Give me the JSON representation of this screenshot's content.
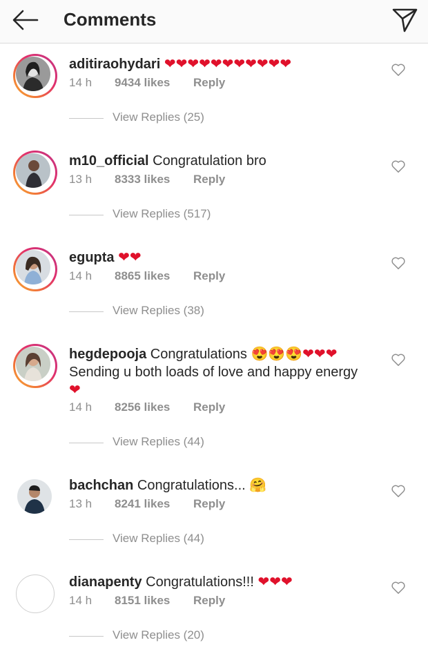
{
  "header": {
    "title": "Comments",
    "back_icon": "arrow-left-icon",
    "direct_icon": "paper-plane-icon"
  },
  "colors": {
    "heart": "#e0112b",
    "muted": "#8e8e8e",
    "story_ring": [
      "#f9b234",
      "#e1306c",
      "#c13584"
    ]
  },
  "comments": [
    {
      "username": "aditiraohydari",
      "text": "",
      "hearts": "❤❤❤❤❤❤❤❤❤❤❤",
      "time": "14 h",
      "likes": "9434 likes",
      "reply": "Reply",
      "view_replies": "View Replies (25)"
    },
    {
      "username": "m10_official",
      "text": "Congratulation bro",
      "hearts": "",
      "time": "13 h",
      "likes": "8333 likes",
      "reply": "Reply",
      "view_replies": "View Replies (517)"
    },
    {
      "username": "egupta",
      "text": "",
      "hearts": "❤❤",
      "time": "14 h",
      "likes": "8865 likes",
      "reply": "Reply",
      "view_replies": "View Replies (38)"
    },
    {
      "username": "hegdepooja",
      "text": "Congratulations",
      "emoji": "😍😍😍",
      "hearts": "❤❤❤",
      "text2": "Sending u both loads of love and happy energy",
      "hearts2": "❤",
      "time": "14 h",
      "likes": "8256 likes",
      "reply": "Reply",
      "view_replies": "View Replies (44)"
    },
    {
      "username": "bachchan",
      "text": "Congratulations...",
      "emoji": "🤗",
      "hearts": "",
      "time": "13 h",
      "likes": "8241 likes",
      "reply": "Reply",
      "view_replies": "View Replies (44)"
    },
    {
      "username": "dianapenty",
      "text": "Congratulations!!!",
      "hearts": "❤❤❤",
      "time": "14 h",
      "likes": "8151 likes",
      "reply": "Reply",
      "view_replies": "View Replies (20)"
    }
  ]
}
